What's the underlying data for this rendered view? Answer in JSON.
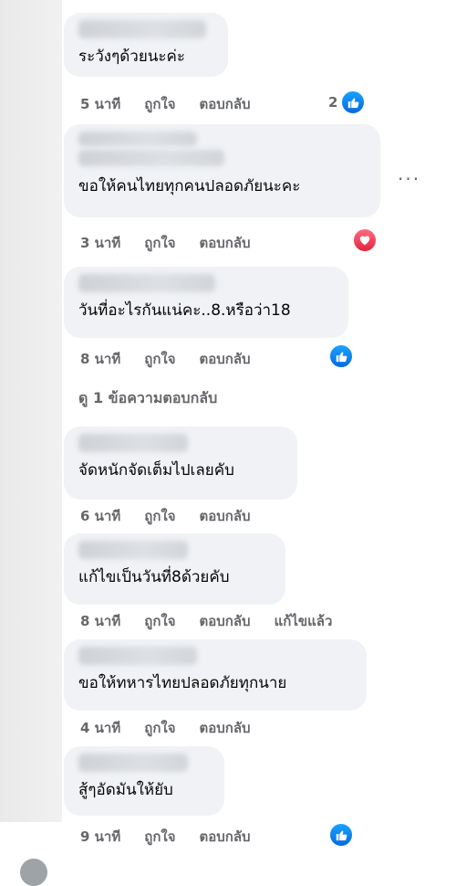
{
  "comments": [
    {
      "text": "ระวังๆด้วยนะค่ะ",
      "time": "5 นาที",
      "like": "ถูกใจ",
      "reply": "ตอบกลับ",
      "reaction_count": "2"
    },
    {
      "text": "ขอให้คนไทยทุกคนปลอดภัยนะคะ",
      "time": "3 นาที",
      "like": "ถูกใจ",
      "reply": "ตอบกลับ"
    },
    {
      "text": "วันที่อะไรกันแน่คะ..8.หรือว่า18",
      "time": "8 นาที",
      "like": "ถูกใจ",
      "reply": "ตอบกลับ"
    },
    {
      "text": "จัดหนักจัดเต็มไปเลยคับ",
      "time": "6 นาที",
      "like": "ถูกใจ",
      "reply": "ตอบกลับ"
    },
    {
      "text": "แก้ไขเป็นวันที่8ด้วยคับ",
      "time": "8 นาที",
      "like": "ถูกใจ",
      "reply": "ตอบกลับ",
      "edited": "แก้ไขแล้ว"
    },
    {
      "text": "ขอให้ทหารไทยปลอดภัยทุกนาย",
      "time": "4 นาที",
      "like": "ถูกใจ",
      "reply": "ตอบกลับ"
    },
    {
      "text": "สู้ๆอัดมันให้ยับ",
      "time": "9 นาที",
      "like": "ถูกใจ",
      "reply": "ตอบกลับ"
    }
  ],
  "see_replies": "ดู 1 ข้อความตอบกลับ",
  "more_menu": "...",
  "colors": {
    "bubble": "#f0f2f5",
    "meta": "#65676b",
    "like": "#1877f2",
    "heart": "#f33e58"
  }
}
